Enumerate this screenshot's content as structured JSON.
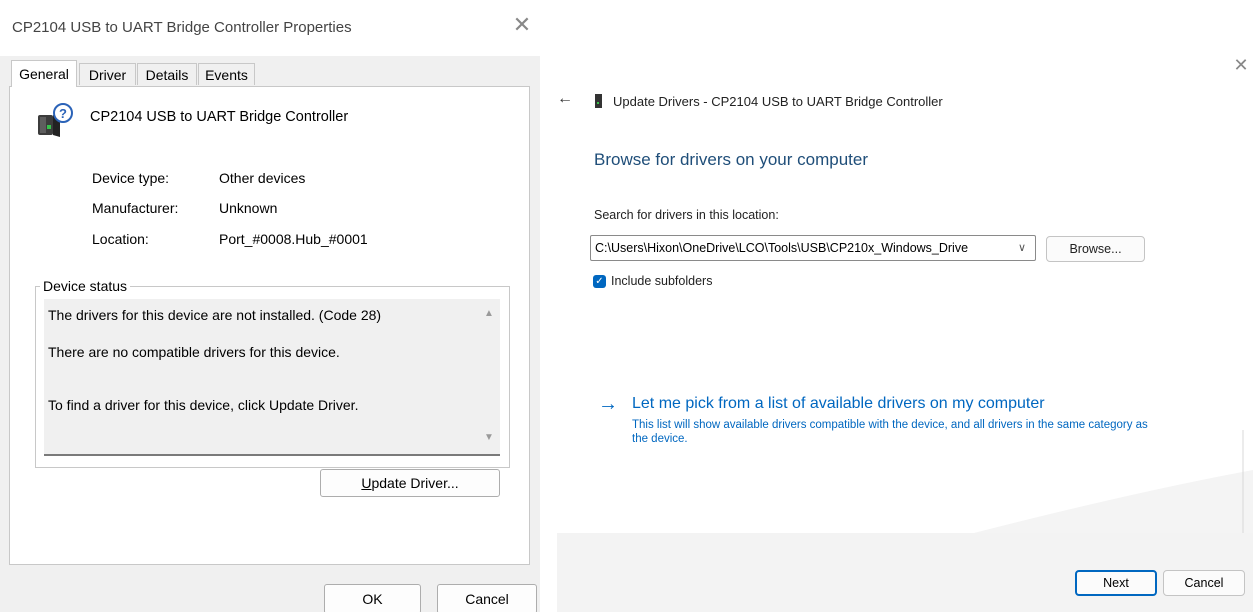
{
  "properties_dialog": {
    "title": "CP2104 USB to UART Bridge Controller Properties",
    "close_glyph": "✕",
    "tabs": [
      {
        "label": "General",
        "active": true
      },
      {
        "label": "Driver",
        "active": false
      },
      {
        "label": "Details",
        "active": false
      },
      {
        "label": "Events",
        "active": false
      }
    ],
    "device_icon": "usb-device-unknown-icon",
    "device_name": "CP2104 USB to UART Bridge Controller",
    "properties": [
      {
        "label": "Device type:",
        "value": "Other devices"
      },
      {
        "label": "Manufacturer:",
        "value": "Unknown"
      },
      {
        "label": "Location:",
        "value": "Port_#0008.Hub_#0001"
      }
    ],
    "status_legend": "Device status",
    "status_lines": [
      "The drivers for this device are not installed. (Code 28)",
      "There are no compatible drivers for this device.",
      "To find a driver for this device, click Update Driver."
    ],
    "update_driver_prefix": "U",
    "update_driver_rest": "pdate Driver...",
    "ok_label": "OK",
    "cancel_label": "Cancel"
  },
  "update_wizard": {
    "close_glyph": "✕",
    "back_glyph": "←",
    "title": "Update Drivers - CP2104 USB to UART Bridge Controller",
    "heading": "Browse for drivers on your computer",
    "search_label": "Search for drivers in this location:",
    "path_value": "C:\\Users\\Hixon\\OneDrive\\LCO\\Tools\\USB\\CP210x_Windows_Drive",
    "browse_label": "Browse...",
    "include_subfolders_label": "Include subfolders",
    "include_subfolders_checked": true,
    "pick_arrow": "→",
    "pick_link": "Let me pick from a list of available drivers on my computer",
    "pick_description": "This list will show available drivers compatible with the device, and all drivers in the same category as the device.",
    "next_label": "Next",
    "cancel_label": "Cancel"
  },
  "colors": {
    "accent": "#0067c0",
    "heading": "#1f4e79",
    "dialog_bg": "#f0f0f0",
    "footer_bg": "#f3f3f3"
  }
}
